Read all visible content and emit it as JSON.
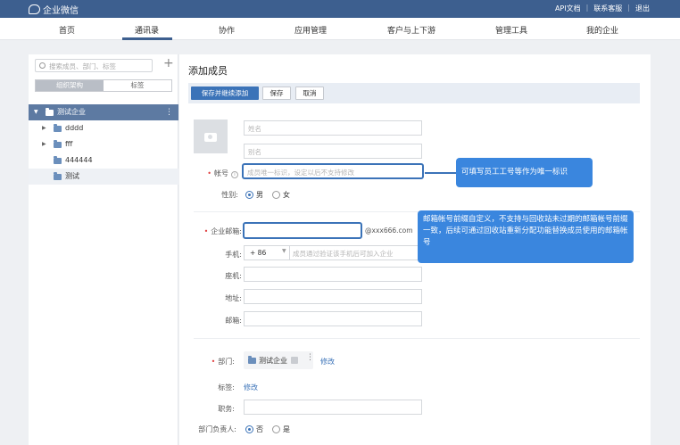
{
  "app": {
    "name": "企业微信"
  },
  "topbar": {
    "links": [
      "API文档",
      "联系客服",
      "退出"
    ]
  },
  "nav": {
    "tabs": [
      "首页",
      "通讯录",
      "协作",
      "应用管理",
      "客户与上下游",
      "管理工具",
      "我的企业"
    ],
    "active": "通讯录"
  },
  "sidebar": {
    "search_placeholder": "搜索成员、部门、标签",
    "segments": [
      "组织架构",
      "标签"
    ],
    "tree": [
      {
        "label": "测试企业",
        "selected": true
      },
      {
        "label": "dddd"
      },
      {
        "label": "fff"
      },
      {
        "label": "444444"
      },
      {
        "label": "测试"
      }
    ]
  },
  "main": {
    "title": "添加成员",
    "buttons": {
      "save_continue": "保存并继续添加",
      "save": "保存",
      "cancel": "取消"
    },
    "fields": {
      "name_placeholder": "姓名",
      "alias_placeholder": "别名",
      "account_label": "帐号",
      "account_placeholder": "成员唯一标识，设定以后不支持修改",
      "gender_label": "性别:",
      "gender_male": "男",
      "gender_female": "女",
      "email_label": "企业邮箱:",
      "email_suffix": "@xxx666.com",
      "phone_label": "手机:",
      "phone_code": "+ 86",
      "phone_placeholder": "成员通过验证该手机后可加入企业",
      "landline_label": "座机:",
      "address_label": "地址:",
      "mail_label": "邮箱:",
      "dept_label": "部门:",
      "dept_value": "测试企业",
      "dept_edit": "修改",
      "tag_label": "标签:",
      "tag_edit": "修改",
      "position_label": "职务:",
      "leader_label": "部门负责人:",
      "leader_no": "否",
      "leader_yes": "是"
    }
  },
  "tips": {
    "account_tip": "可填写员工工号等作为唯一标识",
    "email_tip": "邮箱帐号前缀自定义，不支持与回收站未过期的邮箱帐号前缀一致，后续可通过回收站重新分配功能替换成员使用的邮箱帐号"
  }
}
